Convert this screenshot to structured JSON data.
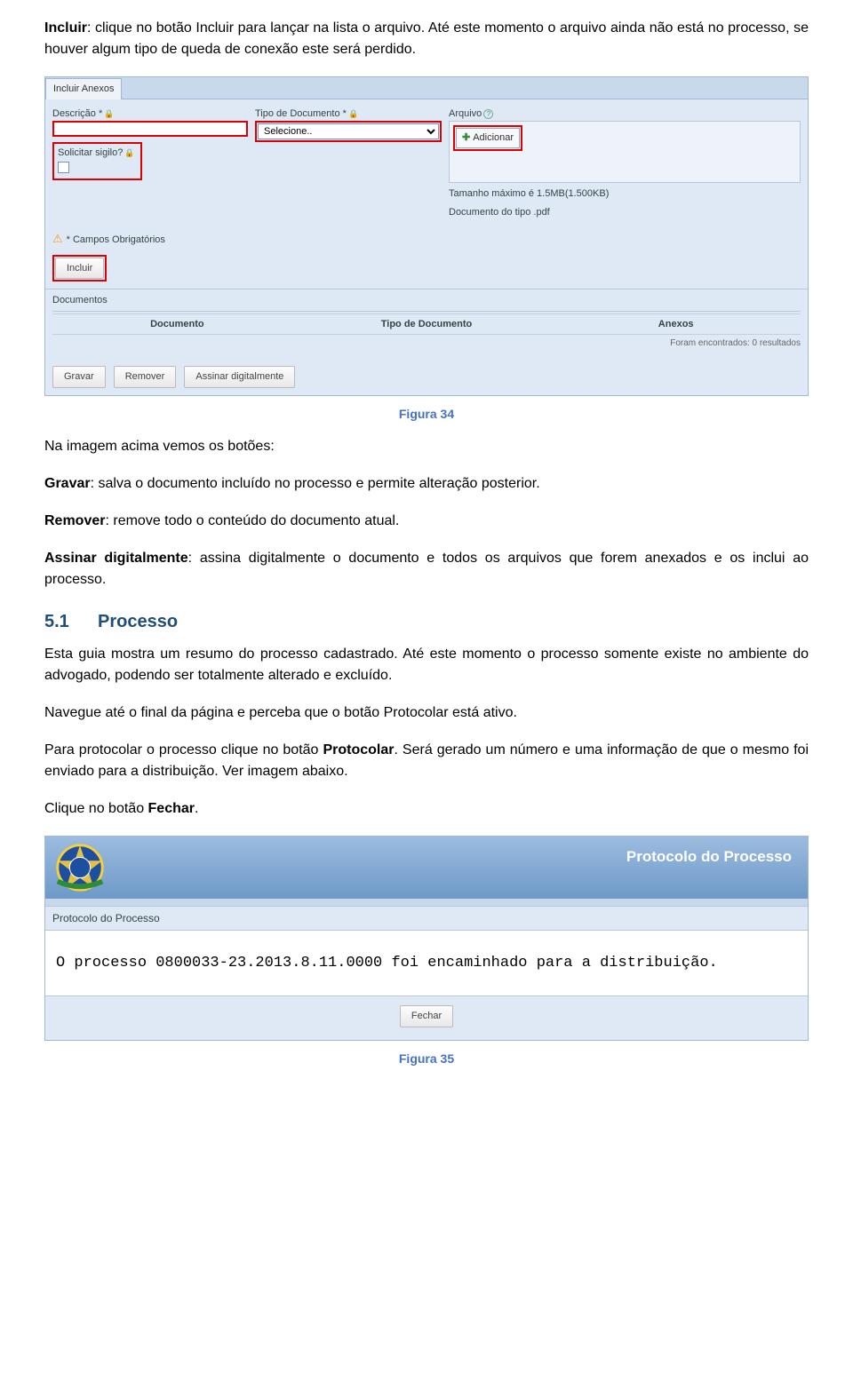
{
  "p1": {
    "lead": "Incluir",
    "rest": ": clique no botão Incluir para lançar na lista o arquivo. Até este momento o arquivo ainda não está no processo, se houver algum tipo de queda de conexão este será perdido."
  },
  "shot1": {
    "tab": "Incluir Anexos",
    "desc_label": "Descrição *",
    "tipo_label": "Tipo de Documento *",
    "tipo_value": "Selecione..",
    "arquivo_label": "Arquivo",
    "add_label": "Adicionar",
    "sigilo_label": "Solicitar sigilo?",
    "tam_line1": "Tamanho máximo é 1.5MB(1.500KB)",
    "tam_line2": "Documento do tipo .pdf",
    "campos_ob": "* Campos Obrigatórios",
    "incluir_btn": "Incluir",
    "docs_label": "Documentos",
    "col_doc": "Documento",
    "col_tipo": "Tipo de Documento",
    "col_anexos": "Anexos",
    "found": "Foram encontrados: 0 resultados",
    "gravar": "Gravar",
    "remover": "Remover",
    "assinar": "Assinar digitalmente"
  },
  "fig1_label": "Figura 34",
  "p2": "Na imagem acima vemos os botões:",
  "p3": {
    "lead": "Gravar",
    "rest": ": salva o documento incluído no processo e permite alteração posterior."
  },
  "p4": {
    "lead": "Remover",
    "rest": ": remove todo o conteúdo do documento atual."
  },
  "p5": {
    "lead": "Assinar digitalmente",
    "rest": ": assina digitalmente o documento e todos os arquivos que forem anexados e os inclui ao processo."
  },
  "sec": {
    "num": "5.1",
    "title": "Processo"
  },
  "p6": "Esta guia mostra um resumo do processo cadastrado. Até este momento o processo somente existe no ambiente do advogado, podendo ser totalmente alterado e excluído.",
  "p7": "Navegue até o final da página e perceba que o botão Protocolar está ativo.",
  "p8": {
    "a": "Para protocolar o processo clique no botão ",
    "b": "Protocolar",
    "c": ". Será gerado um número e uma informação de que o mesmo foi enviado para a distribuição. Ver imagem abaixo."
  },
  "p9": {
    "a": "Clique no botão ",
    "b": "Fechar",
    "c": "."
  },
  "shot2": {
    "title": "Protocolo do Processo",
    "sub": "Protocolo do Processo",
    "msg": "O processo 0800033-23.2013.8.11.0000 foi encaminhado para a distribuição.",
    "fechar": "Fechar"
  },
  "fig2_label": "Figura 35"
}
